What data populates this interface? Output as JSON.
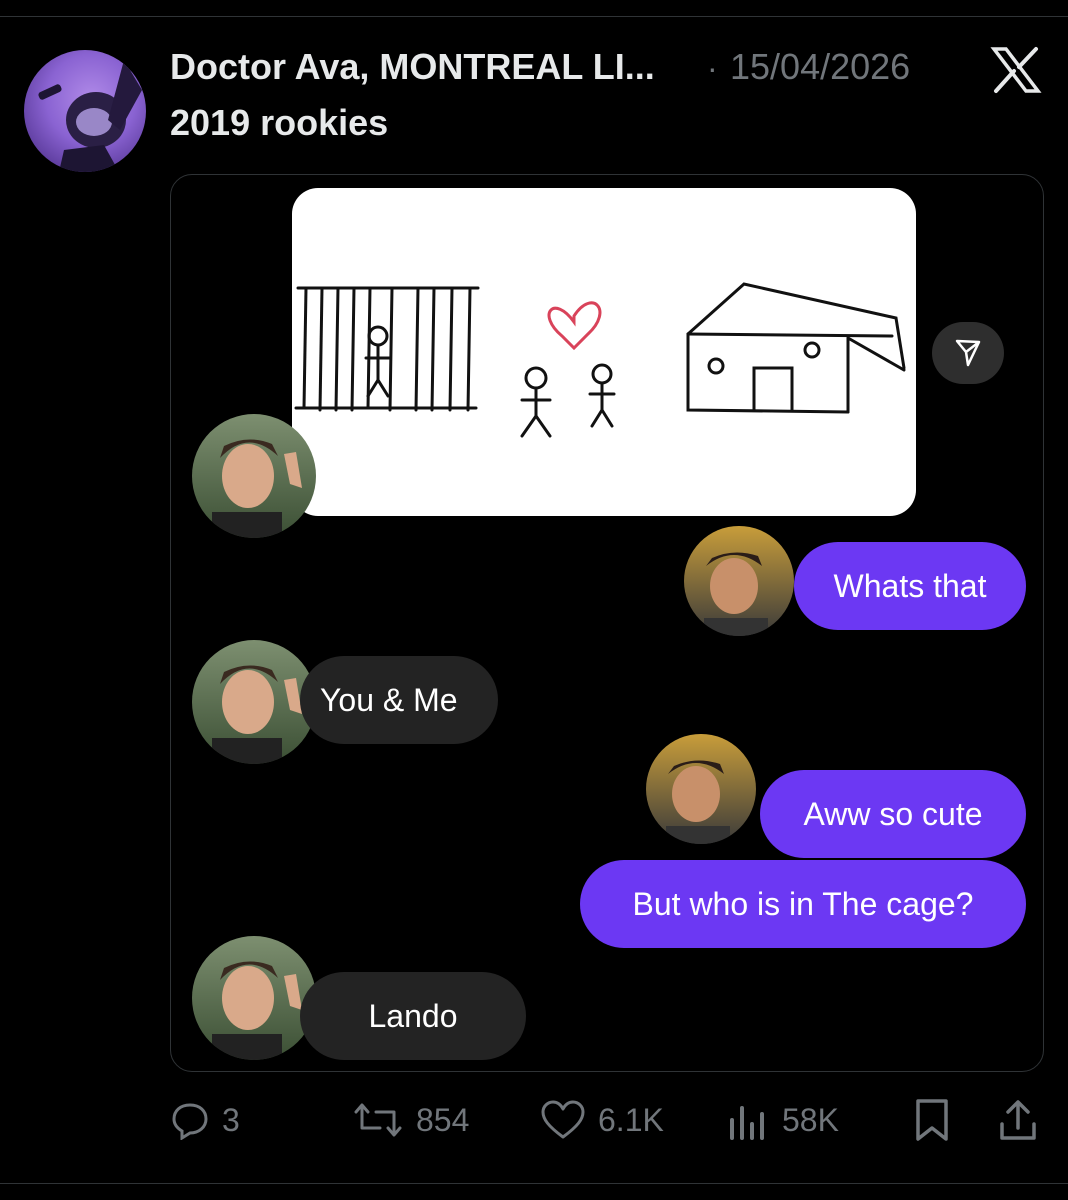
{
  "post": {
    "author": "Doctor Ava, MONTREAL LI...",
    "separator": "·",
    "date": "15/04/2026",
    "text": "2019 rookies"
  },
  "chat": {
    "messages": [
      {
        "side": "out",
        "text": "Whats that"
      },
      {
        "side": "in",
        "text": "You & Me"
      },
      {
        "side": "out",
        "text": "Aww so cute"
      },
      {
        "side": "out",
        "text": "But who is in The cage?"
      },
      {
        "side": "in",
        "text": "Lando"
      }
    ]
  },
  "actions": {
    "replies": "3",
    "reposts": "854",
    "likes": "6.1K",
    "views": "58K"
  },
  "colors": {
    "accent_purple": "#6c38f3",
    "incoming_bubble": "#232323",
    "muted_text": "#71767b",
    "heart_red": "#d9435a"
  },
  "icons": [
    "x-logo-icon",
    "send-icon",
    "reply-icon",
    "repost-icon",
    "like-icon",
    "views-icon",
    "bookmark-icon",
    "share-icon"
  ]
}
